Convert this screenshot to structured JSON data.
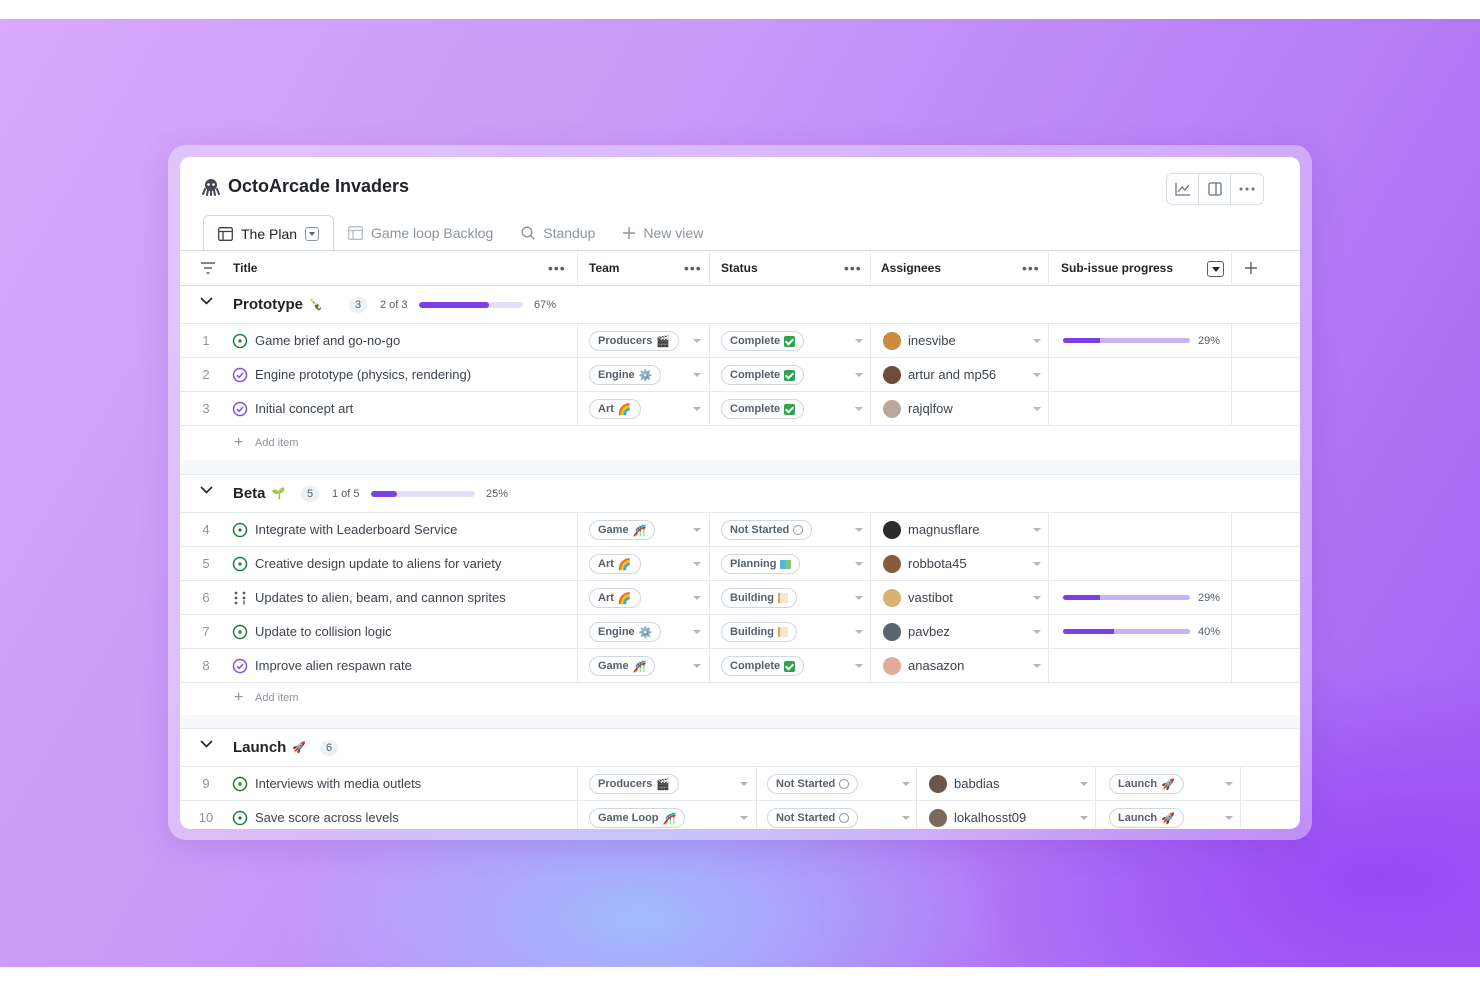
{
  "project": {
    "title": "OctoArcade Invaders"
  },
  "header_tools": [
    {
      "icon": "insights-icon"
    },
    {
      "icon": "panel-icon"
    },
    {
      "icon": "more-icon"
    }
  ],
  "tabs": [
    {
      "label": "The Plan",
      "icon": "table-icon",
      "active": true
    },
    {
      "label": "Game loop Backlog",
      "icon": "table-icon"
    },
    {
      "label": "Standup",
      "icon": "search-icon"
    },
    {
      "label": "New view",
      "icon": "plus-icon"
    }
  ],
  "columns": {
    "title": "Title",
    "team": "Team",
    "status": "Status",
    "assignees": "Assignees",
    "subissue": "Sub-issue progress"
  },
  "groups": [
    {
      "name": "Prototype",
      "emoji": "🍾",
      "count": "3",
      "of": "2 of 3",
      "progress": 0.67,
      "pct": "67%",
      "rows": [
        {
          "num": "1",
          "state": "open",
          "title": "Game brief and go-no-go",
          "team": "Producers",
          "team_emoji": "🎬",
          "status": "Complete",
          "status_icon": "check",
          "assignee": "inesvibe",
          "avatar_color": "#c98b3e",
          "sub": "29%",
          "sub_value": 0.29
        },
        {
          "num": "2",
          "state": "closed",
          "title": "Engine prototype (physics, rendering)",
          "team": "Engine",
          "team_emoji": "⚙️",
          "status": "Complete",
          "status_icon": "check",
          "assignee": "artur and mp56",
          "avatar_color": "#6e4b3a"
        },
        {
          "num": "3",
          "state": "closed",
          "title": "Initial concept art",
          "team": "Art",
          "team_emoji": "🌈",
          "status": "Complete",
          "status_icon": "check",
          "assignee": "rajqlfow",
          "avatar_color": "#b8a89a"
        }
      ],
      "add_item": "Add item"
    },
    {
      "name": "Beta",
      "emoji": "🌱",
      "count": "5",
      "of": "1 of 5",
      "progress": 0.25,
      "pct": "25%",
      "rows": [
        {
          "num": "4",
          "state": "open",
          "title": "Integrate with Leaderboard Service",
          "team": "Game",
          "team_emoji": "🎢",
          "status": "Not Started",
          "status_icon": "hourglass",
          "assignee": "magnusflare",
          "avatar_color": "#2b2b2b"
        },
        {
          "num": "5",
          "state": "open",
          "title": "Creative design update to aliens for variety",
          "team": "Art",
          "team_emoji": "🌈",
          "status": "Planning",
          "status_icon": "map",
          "assignee": "robbota45",
          "avatar_color": "#8a5a3c"
        },
        {
          "num": "6",
          "state": "draft",
          "title": "Updates to alien, beam, and cannon sprites",
          "team": "Art",
          "team_emoji": "🌈",
          "status": "Building",
          "status_icon": "flag",
          "assignee": "vastibot",
          "avatar_color": "#d9b26f",
          "sub": "29%",
          "sub_value": 0.29
        },
        {
          "num": "7",
          "state": "open",
          "title": "Update to collision logic",
          "team": "Engine",
          "team_emoji": "⚙️",
          "status": "Building",
          "status_icon": "flag",
          "assignee": "pavbez",
          "avatar_color": "#5a6470",
          "sub": "40%",
          "sub_value": 0.4
        },
        {
          "num": "8",
          "state": "closed",
          "title": "Improve alien respawn rate",
          "team": "Game",
          "team_emoji": "🎢",
          "status": "Complete",
          "status_icon": "check",
          "assignee": "anasazon",
          "avatar_color": "#e3a99a"
        }
      ],
      "add_item": "Add item"
    },
    {
      "name": "Launch",
      "emoji": "🚀",
      "count": "6",
      "rows": [
        {
          "num": "9",
          "state": "open",
          "title": "Interviews with media outlets",
          "team": "Producers",
          "team_emoji": "🎬",
          "status": "Not Started",
          "status_icon": "hourglass",
          "assignee": "babdias",
          "avatar_color": "#6b5547",
          "milestone": "Launch",
          "milestone_emoji": "🚀"
        },
        {
          "num": "10",
          "state": "open",
          "title": "Save score across levels",
          "team": "Game Loop",
          "team_emoji": "🎢",
          "status": "Not Started",
          "status_icon": "hourglass",
          "assignee": "lokalhosst09",
          "avatar_color": "#7a6a5a",
          "milestone": "Launch",
          "milestone_emoji": "🚀"
        }
      ]
    }
  ]
}
